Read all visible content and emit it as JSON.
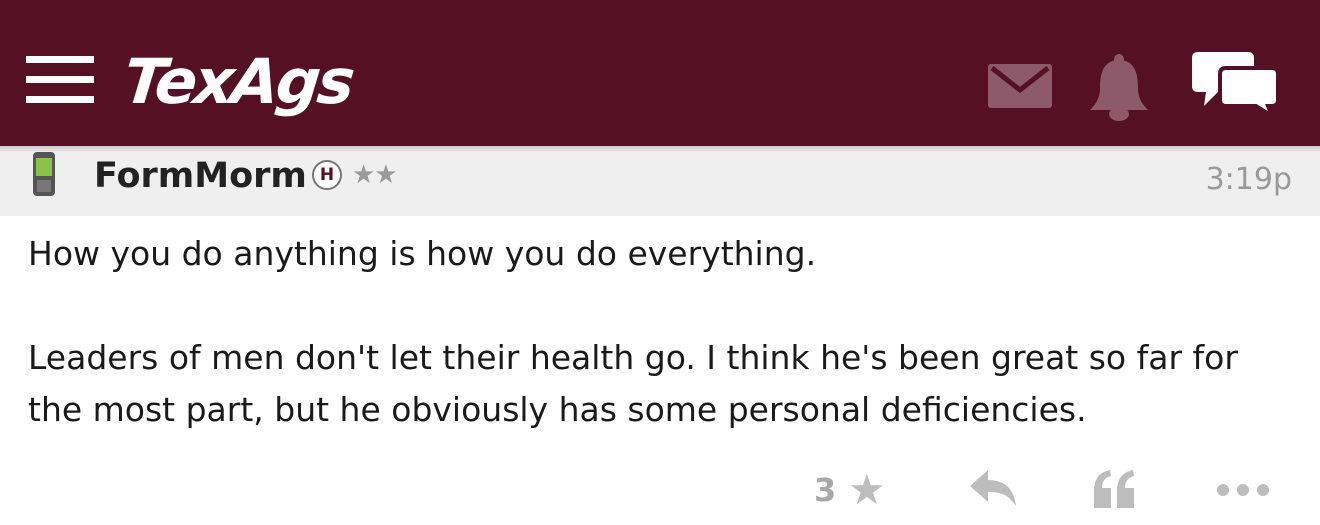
{
  "app_bar": {
    "logo_text": "TexAgs",
    "background_color": "#561026",
    "icons": {
      "menu": "hamburger-menu-icon",
      "mail": "envelope-icon",
      "notifications": "bell-icon",
      "chat": "chat-bubbles-icon"
    }
  },
  "post": {
    "device_icon": "mobile-phone-icon",
    "username": "FormMorm",
    "badge": "H",
    "rank_stars": "★★",
    "timestamp": "3:19p",
    "body": [
      "How you do anything is how you do everything.",
      "Leaders of men don't let their health go. I think he's been great so far for the most part, but he obviously has some personal deficiencies."
    ],
    "actions": {
      "star_count": "3",
      "star_icon": "star-icon",
      "reply_icon": "reply-arrow-icon",
      "quote_icon": "quote-icon",
      "more_icon": "more-dots-icon"
    }
  }
}
